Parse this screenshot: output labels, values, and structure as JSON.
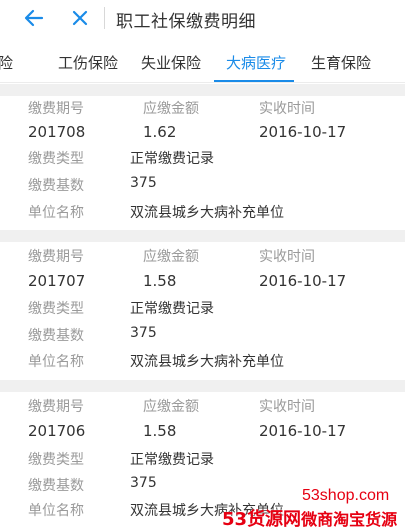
{
  "header": {
    "title": "职工社保缴费明细",
    "back_icon": "back-arrow-icon",
    "close_icon": "close-icon"
  },
  "tabs": [
    {
      "label": "险"
    },
    {
      "label": "工伤保险"
    },
    {
      "label": "失业保险"
    },
    {
      "label": "大病医疗",
      "active": true
    },
    {
      "label": "生育保险"
    }
  ],
  "columns": {
    "period": "缴费期号",
    "amount": "应缴金额",
    "received_time": "实收时间"
  },
  "field_labels": {
    "type": "缴费类型",
    "base": "缴费基数",
    "unit": "单位名称"
  },
  "records": [
    {
      "period": "201708",
      "amount": "1.62",
      "received_time": "2016-10-17",
      "type": "正常缴费记录",
      "base": "375",
      "unit": "双流县城乡大病补充单位"
    },
    {
      "period": "201707",
      "amount": "1.58",
      "received_time": "2016-10-17",
      "type": "正常缴费记录",
      "base": "375",
      "unit": "双流县城乡大病补充单位"
    },
    {
      "period": "201706",
      "amount": "1.58",
      "received_time": "2016-10-17",
      "type": "正常缴费记录",
      "base": "375",
      "unit": "双流县城乡大病补充单位"
    }
  ],
  "watermark": {
    "line1": "53shop.com",
    "line2_num": "53",
    "line2_text": "货源网",
    "line2_suffix": "微商淘宝货源"
  },
  "colors": {
    "accent": "#1a8be8",
    "watermark": "#e60012"
  }
}
